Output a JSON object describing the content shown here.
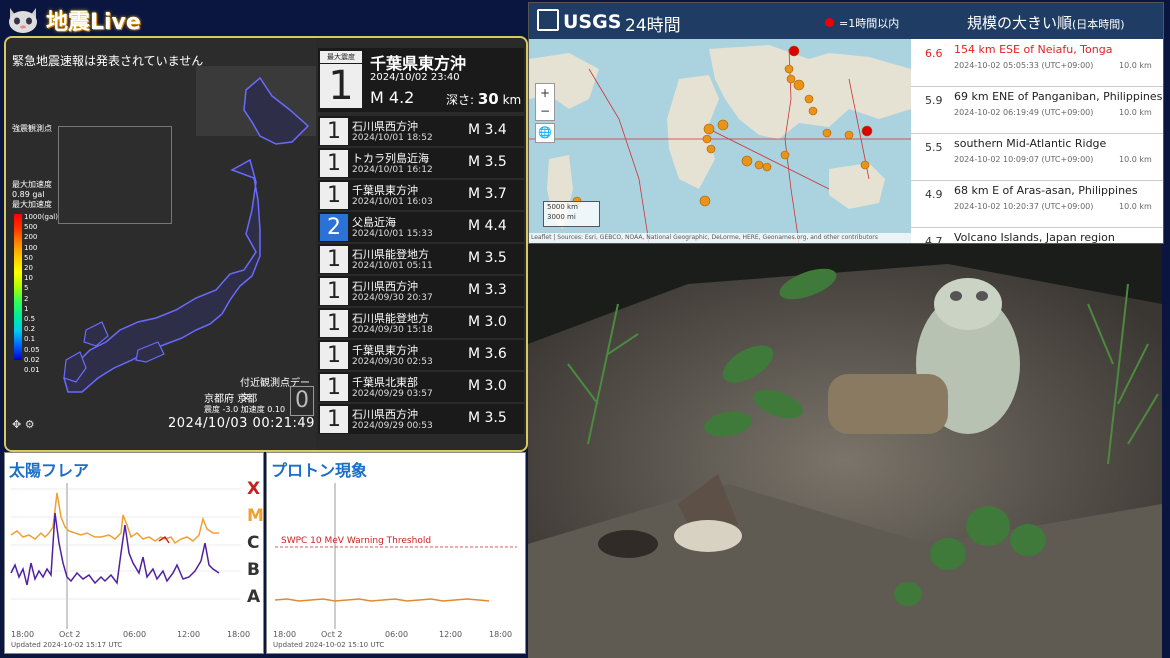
{
  "header": {
    "title": "地震Live",
    "icon": "cat-face-icon"
  },
  "eq_panel": {
    "eew_status": "緊急地震速報は発表されていません",
    "station_label": "強震観測点",
    "accel": {
      "peak_label": "最大加速度",
      "peak_value": "0.89 gal",
      "scale_label": "最大加速度"
    },
    "scale_ticks": [
      "1000(gal)",
      "500",
      "200",
      "100",
      "50",
      "20",
      "10",
      "5",
      "2",
      "1",
      "0.5",
      "0.2",
      "0.1",
      "0.05",
      "0.02",
      "0.01"
    ],
    "nearby": {
      "heading": "付近観測点データ",
      "pref": "京都府 京都",
      "intensity_label": "震度",
      "intensity_value": "-3.0",
      "accel_label": "加速度",
      "accel_value": "0.10",
      "big_value": "0"
    },
    "clock": "2024/10/03 00:21:49",
    "main": {
      "tag": "最大震度",
      "intensity": "1",
      "location": "千葉県東方沖",
      "time": "2024/10/02 23:40",
      "magnitude": "M 4.2",
      "depth_label": "深さ:",
      "depth_value": "30",
      "depth_unit": "km"
    },
    "list": [
      {
        "intensity": "1",
        "location": "石川県西方沖",
        "time": "2024/10/01 18:52",
        "magnitude": "M 3.4",
        "blue": false
      },
      {
        "intensity": "1",
        "location": "トカラ列島近海",
        "time": "2024/10/01 16:12",
        "magnitude": "M 3.5",
        "blue": false
      },
      {
        "intensity": "1",
        "location": "千葉県東方沖",
        "time": "2024/10/01 16:03",
        "magnitude": "M 3.7",
        "blue": false
      },
      {
        "intensity": "2",
        "location": "父島近海",
        "time": "2024/10/01 15:33",
        "magnitude": "M 4.4",
        "blue": true
      },
      {
        "intensity": "1",
        "location": "石川県能登地方",
        "time": "2024/10/01 05:11",
        "magnitude": "M 3.5",
        "blue": false
      },
      {
        "intensity": "1",
        "location": "石川県西方沖",
        "time": "2024/09/30 20:37",
        "magnitude": "M 3.3",
        "blue": false
      },
      {
        "intensity": "1",
        "location": "石川県能登地方",
        "time": "2024/09/30 15:18",
        "magnitude": "M 3.0",
        "blue": false
      },
      {
        "intensity": "1",
        "location": "千葉県東方沖",
        "time": "2024/09/30 02:53",
        "magnitude": "M 3.6",
        "blue": false
      },
      {
        "intensity": "1",
        "location": "千葉県北東部",
        "time": "2024/09/29 03:57",
        "magnitude": "M 3.0",
        "blue": false
      },
      {
        "intensity": "1",
        "location": "石川県西方沖",
        "time": "2024/09/29 00:53",
        "magnitude": "M 3.5",
        "blue": false
      }
    ]
  },
  "usgs": {
    "logo": "USGS",
    "period": "24時間",
    "hour_legend": "=1時間以内",
    "sort_label": "規模の大きい順",
    "sort_sub": "(日本時間)",
    "zoom_in": "+",
    "zoom_out": "−",
    "scale_km": "5000 km",
    "scale_mi": "3000 mi",
    "attribution": "Leaflet | Sources: Esri, GEBCO, NOAA, National Geographic, DeLorme, HERE, Geonames.org, and other contributors",
    "quakes": [
      {
        "mag": "6.6",
        "place": "154 km ESE of Neiafu, Tonga",
        "time": "2024-10-02 05:05:33 (UTC+09:00)",
        "depth": "10.0 km",
        "recent": true
      },
      {
        "mag": "5.9",
        "place": "69 km ENE of Panganiban, Philippines",
        "time": "2024-10-02 06:19:49 (UTC+09:00)",
        "depth": "10.0 km",
        "recent": false
      },
      {
        "mag": "5.5",
        "place": "southern Mid-Atlantic Ridge",
        "time": "2024-10-02 10:09:07 (UTC+09:00)",
        "depth": "10.0 km",
        "recent": false
      },
      {
        "mag": "4.9",
        "place": "68 km E of Aras-asan, Philippines",
        "time": "2024-10-02 10:20:37 (UTC+09:00)",
        "depth": "10.0 km",
        "recent": false
      },
      {
        "mag": "4.7",
        "place": "Volcano Islands, Japan region",
        "time": "",
        "depth": "",
        "recent": false
      }
    ]
  },
  "flare": {
    "title": "太陽フレア",
    "classes": [
      "X",
      "M",
      "C",
      "B",
      "A"
    ],
    "x_ticks": [
      "18:00",
      "Oct 2",
      "06:00",
      "12:00",
      "18:00"
    ],
    "updated": "Updated 2024-10-02 15:17 UTC"
  },
  "proton": {
    "title": "プロトン現象",
    "threshold": "SWPC 10 MeV Warning Threshold",
    "x_ticks": [
      "18:00",
      "Oct 2",
      "06:00",
      "12:00",
      "18:00"
    ],
    "updated": "Updated 2024-10-02 15:10 UTC"
  },
  "colors": {
    "panel_border": "#d8c860",
    "usgs_header": "#1e3c64",
    "intensity_blue": "#2a72d8",
    "flare_orange": "#f0a030",
    "flare_purple": "#5020a0",
    "threshold_red": "#cc2222"
  }
}
